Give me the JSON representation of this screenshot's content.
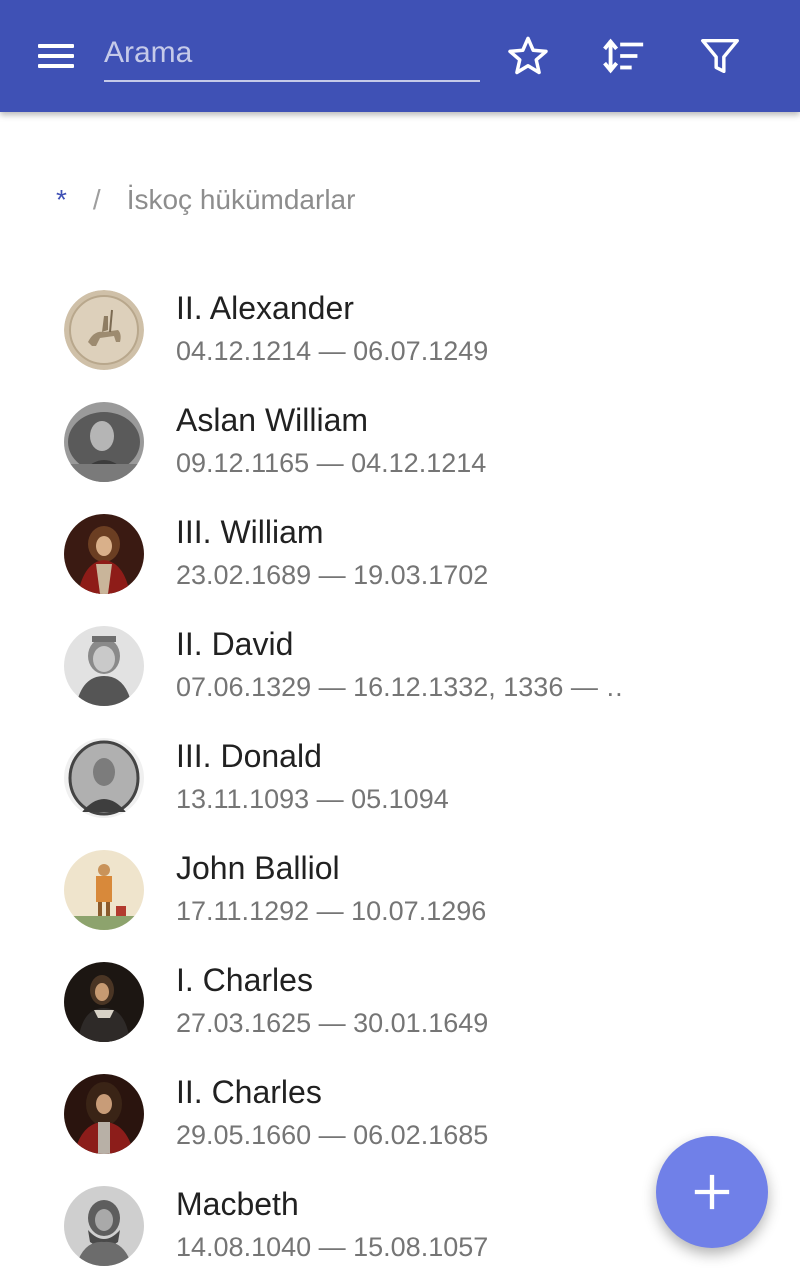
{
  "appbar": {
    "color": "#3f51b5",
    "menu_icon": "hamburger-menu-icon",
    "search": {
      "placeholder": "Arama",
      "value": ""
    },
    "actions": [
      {
        "icon": "star-outline-icon"
      },
      {
        "icon": "sort-icon"
      },
      {
        "icon": "filter-icon"
      }
    ]
  },
  "breadcrumb": {
    "root": "*",
    "separator": "/",
    "current": "İskoç hükümdarlar"
  },
  "list": {
    "items": [
      {
        "title": "II. Alexander",
        "subtitle": "04.12.1214 — 06.07.1249",
        "avatar": "seal-rider-avatar"
      },
      {
        "title": "Aslan William",
        "subtitle": "09.12.1165 — 04.12.1214",
        "avatar": "portrait-avatar"
      },
      {
        "title": "III. William",
        "subtitle": "23.02.1689 — 19.03.1702",
        "avatar": "portrait-avatar"
      },
      {
        "title": "II. David",
        "subtitle": "07.06.1329 — 16.12.1332, 1336 — …",
        "avatar": "portrait-avatar"
      },
      {
        "title": "III. Donald",
        "subtitle": "13.11.1093 — 05.1094",
        "avatar": "portrait-avatar"
      },
      {
        "title": "John Balliol",
        "subtitle": "17.11.1292 — 10.07.1296",
        "avatar": "illustration-avatar"
      },
      {
        "title": "I. Charles",
        "subtitle": "27.03.1625 — 30.01.1649",
        "avatar": "portrait-avatar"
      },
      {
        "title": "II. Charles",
        "subtitle": "29.05.1660 — 06.02.1685",
        "avatar": "portrait-avatar"
      },
      {
        "title": "Macbeth",
        "subtitle": "14.08.1040 — 15.08.1057",
        "avatar": "portrait-avatar"
      }
    ]
  },
  "fab": {
    "icon": "plus-icon",
    "color": "#7080e8"
  }
}
